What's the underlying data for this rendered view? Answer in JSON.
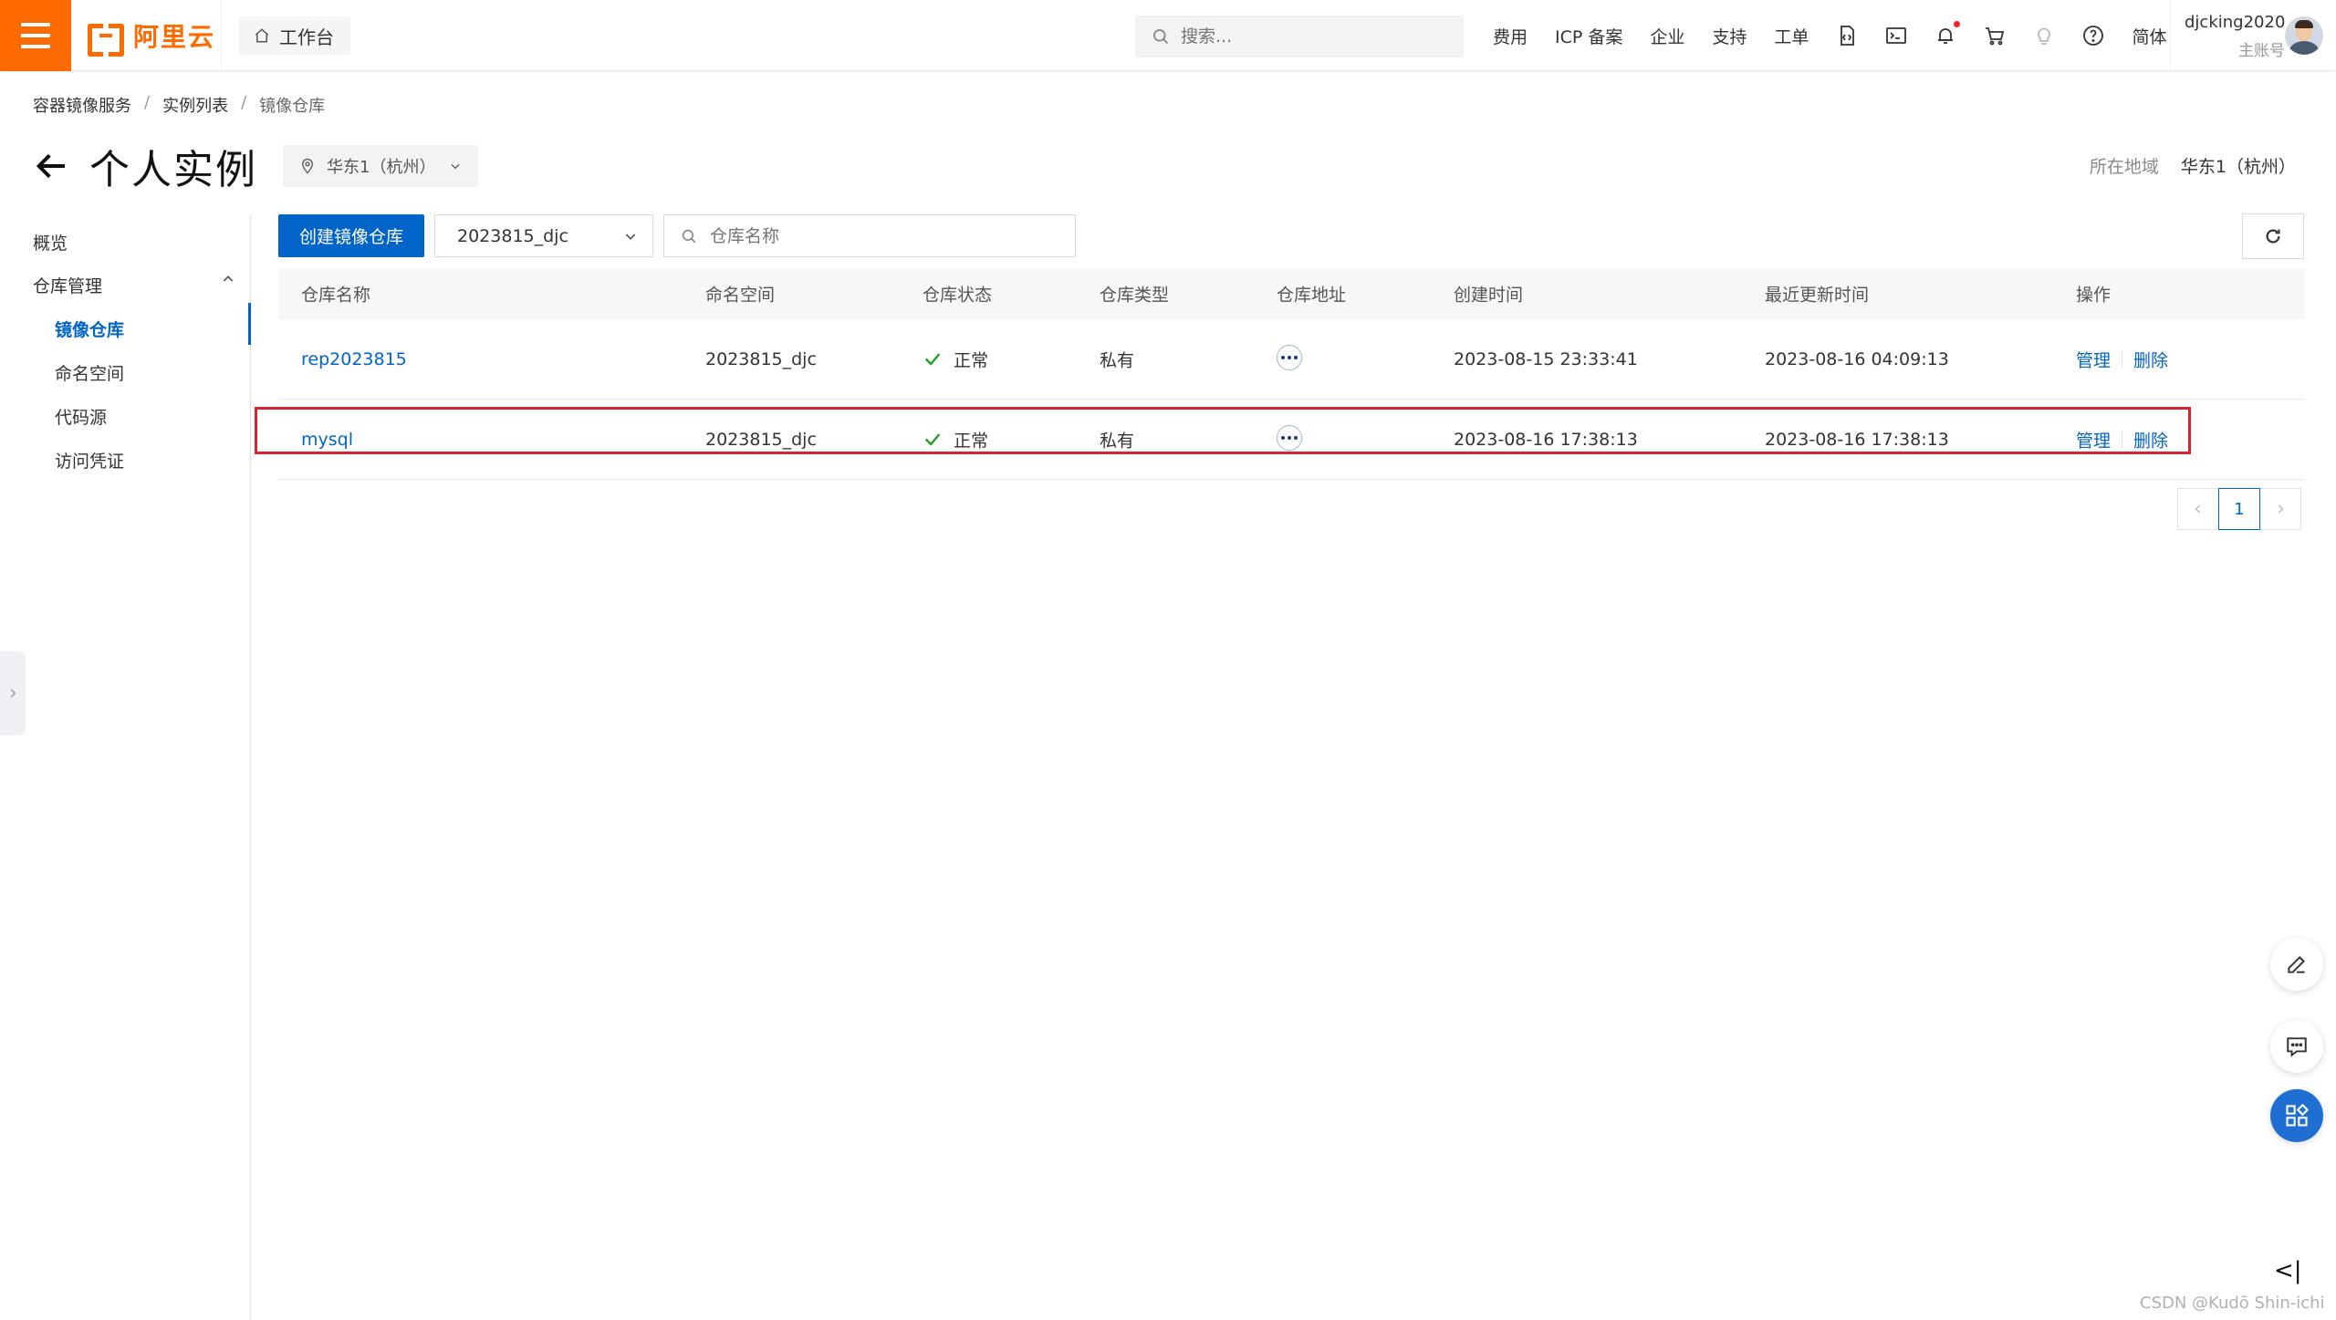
{
  "topbar": {
    "brand": "阿里云",
    "workbench_label": "工作台",
    "search_placeholder": "搜索...",
    "links": [
      "费用",
      "ICP 备案",
      "企业",
      "支持",
      "工单"
    ],
    "language": "简体",
    "user_name": "djcking2020",
    "user_role": "主账号",
    "icons": [
      "code-icon",
      "terminal-icon",
      "bell-icon",
      "cart-icon",
      "lightbulb-icon",
      "help-icon"
    ]
  },
  "breadcrumb": [
    "容器镜像服务",
    "实例列表",
    "镜像仓库"
  ],
  "page": {
    "title": "个人实例",
    "region_selected": "华东1（杭州）",
    "region_label": "所在地域",
    "region_value": "华东1（杭州）"
  },
  "sidebar": {
    "overview": "概览",
    "repo_management": "仓库管理",
    "sub_items": [
      "镜像仓库",
      "命名空间",
      "代码源",
      "访问凭证"
    ],
    "active_index": 0
  },
  "toolbar": {
    "create_button": "创建镜像仓库",
    "namespace_selected": "2023815_djc",
    "repo_search_placeholder": "仓库名称"
  },
  "table": {
    "columns": [
      "仓库名称",
      "命名空间",
      "仓库状态",
      "仓库类型",
      "仓库地址",
      "创建时间",
      "最近更新时间",
      "操作"
    ],
    "rows": [
      {
        "name": "rep2023815",
        "namespace": "2023815_djc",
        "status": "正常",
        "type": "私有",
        "created": "2023-08-15 23:33:41",
        "updated": "2023-08-16 04:09:13",
        "op_manage": "管理",
        "op_delete": "删除"
      },
      {
        "name": "mysql",
        "namespace": "2023815_djc",
        "status": "正常",
        "type": "私有",
        "created": "2023-08-16 17:38:13",
        "updated": "2023-08-16 17:38:13",
        "op_manage": "管理",
        "op_delete": "删除"
      }
    ],
    "highlighted_row": 1
  },
  "pagination": {
    "current_page": "1"
  },
  "colors": {
    "brand_orange": "#ff6a00",
    "primary_blue": "#0064c8",
    "status_green": "#23a023",
    "highlight_red": "#d9232f"
  },
  "watermark": "CSDN @Kudō Shin-ichi"
}
